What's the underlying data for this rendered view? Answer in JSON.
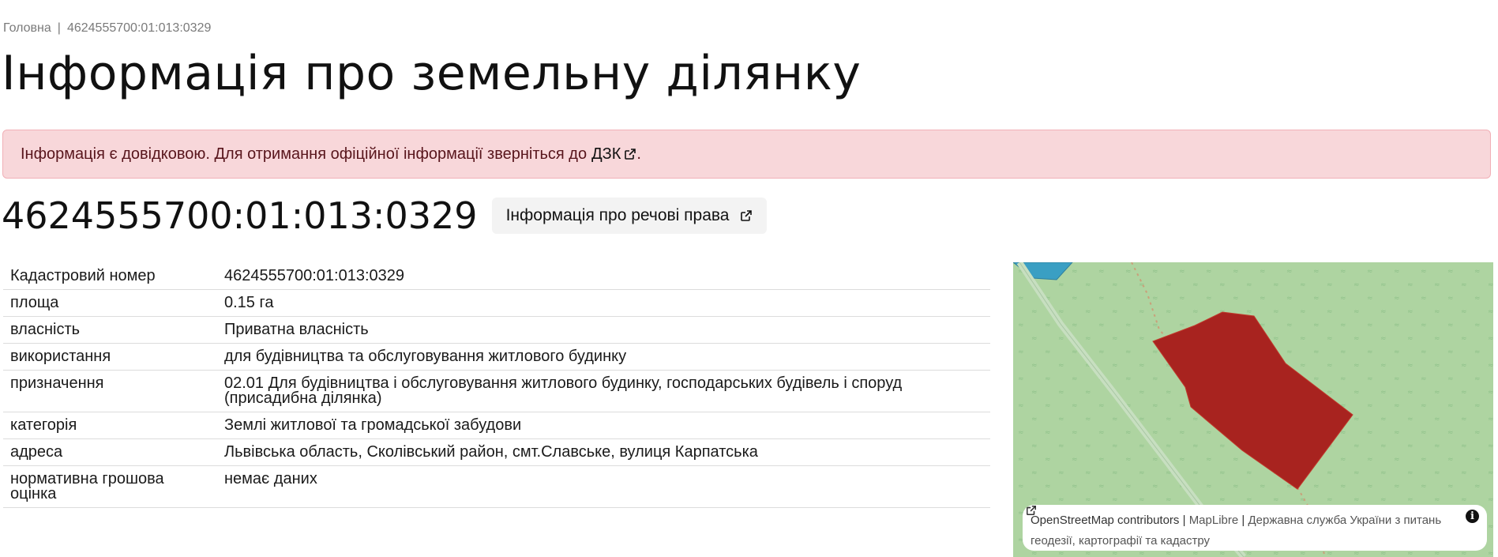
{
  "breadcrumb": {
    "home": "Головна",
    "separator": "|",
    "current": "4624555700:01:013:0329"
  },
  "page_title": "Інформація про земельну ділянку",
  "alert": {
    "text": "Інформація є довідковою. Для отримання офіційної інформації зверніться до",
    "link_label": "ДЗК",
    "suffix": "."
  },
  "parcel": {
    "number": "4624555700:01:013:0329",
    "rights_button": "Інформація про речові права"
  },
  "table": [
    {
      "key": "Кадастровий номер",
      "value": "4624555700:01:013:0329"
    },
    {
      "key": "площа",
      "value": "0.15 га"
    },
    {
      "key": "власність",
      "value": "Приватна власність"
    },
    {
      "key": "використання",
      "value": "для будівництва та обслуговування житлового будинку"
    },
    {
      "key": "призначення",
      "value": "02.01 Для будівництва і обслуговування житлового будинку, господарських будівель і споруд (присадибна ділянка)"
    },
    {
      "key": "категорія",
      "value": "Землі житлової та громадської забудови"
    },
    {
      "key": "адреса",
      "value": "Львівська область, Сколівський район, смт.Славське, вулиця Карпатська"
    },
    {
      "key": "нормативна грошова оцінка",
      "value": "немає даних"
    }
  ],
  "map": {
    "attribution": {
      "osm": "OpenStreetMap contributors",
      "sep": "|",
      "maplibre": "MapLibre",
      "agency": "Державна служба України з питань геодезії, картографії та кадастру"
    },
    "colors": {
      "background": "#aed4a1",
      "parcel": "#a8231f",
      "water": "#3a9fc3",
      "path": "#c9a07a"
    }
  },
  "icons": {
    "external_link": "external-link-icon",
    "info": "info-icon"
  }
}
